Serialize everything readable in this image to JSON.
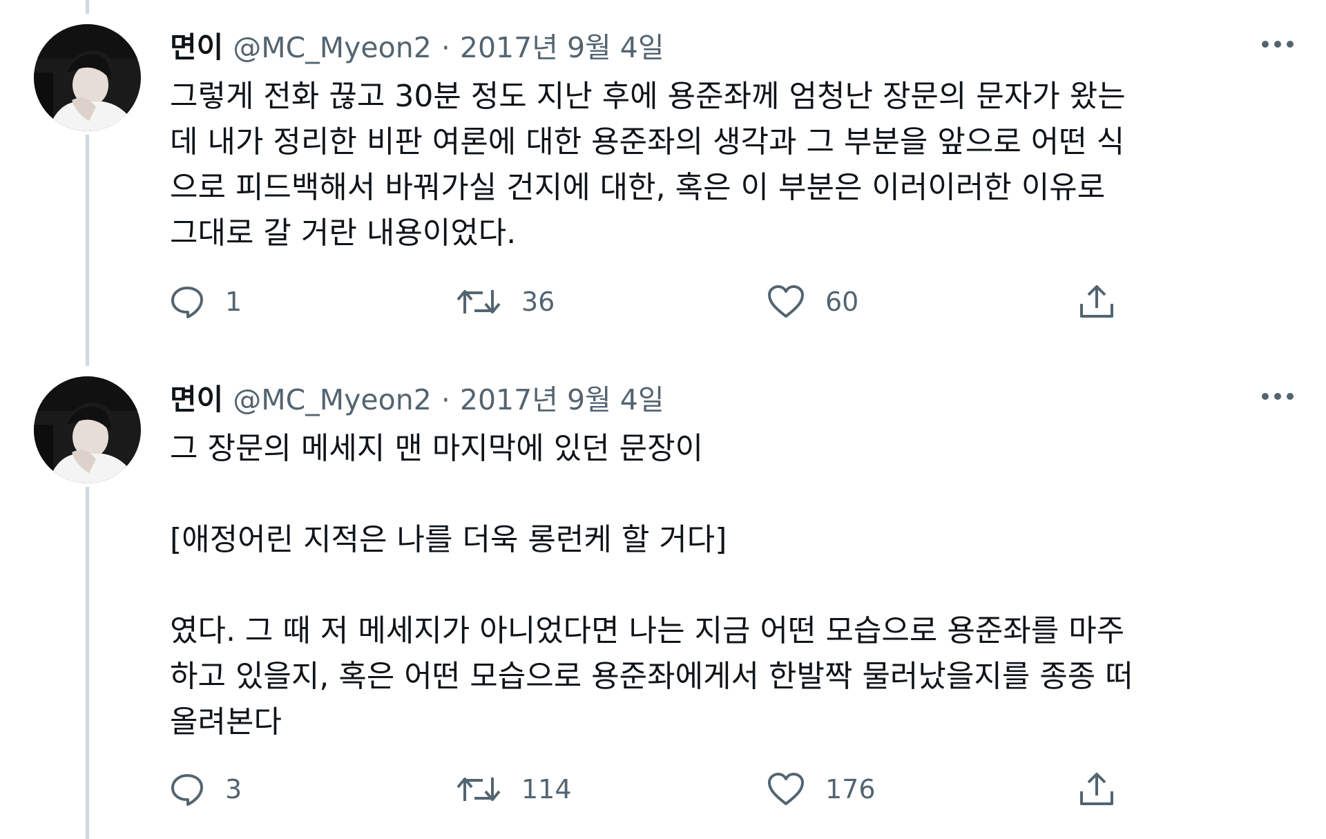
{
  "tweets": [
    {
      "author": {
        "name": "면이",
        "handle": "@MC_Myeon2",
        "separator": "·",
        "date": "2017년 9월 4일"
      },
      "text": [
        "그렇게 전화 끊고 30분 정도 지난 후에 용준좌께 엄청난 장문의 문자가 왔는",
        "데 내가 정리한 비판 여론에 대한 용준좌의 생각과 그 부분을 앞으로 어떤 식",
        "으로 피드백해서 바꿔가실 건지에 대한, 혹은 이 부분은 이러이러한 이유로",
        "그대로 갈 거란 내용이었다."
      ],
      "stats": {
        "replies": "1",
        "retweets": "36",
        "likes": "60"
      }
    },
    {
      "author": {
        "name": "면이",
        "handle": "@MC_Myeon2",
        "separator": "·",
        "date": "2017년 9월 4일"
      },
      "text": [
        "그 장문의 메세지 맨 마지막에 있던 문장이",
        "",
        "[애정어린 지적은 나를 더욱 롱런케 할 거다]",
        "",
        "였다. 그 때 저 메세지가 아니었다면 나는 지금 어떤 모습으로 용준좌를 마주",
        "하고 있을지, 혹은 어떤 모습으로 용준좌에게서 한발짝 물러났을지를 종종 떠",
        "올려본다"
      ],
      "stats": {
        "replies": "3",
        "retweets": "114",
        "likes": "176"
      }
    }
  ],
  "icons": {
    "reply": "speech-bubble-icon",
    "retweet": "retweet-arrows-icon",
    "like": "heart-icon",
    "share": "share-upload-icon",
    "more": "three-dots-icon"
  },
  "colors": {
    "text": "#0f1419",
    "secondary": "#536471",
    "thread_line": "#cfd9de",
    "background": "#ffffff"
  }
}
